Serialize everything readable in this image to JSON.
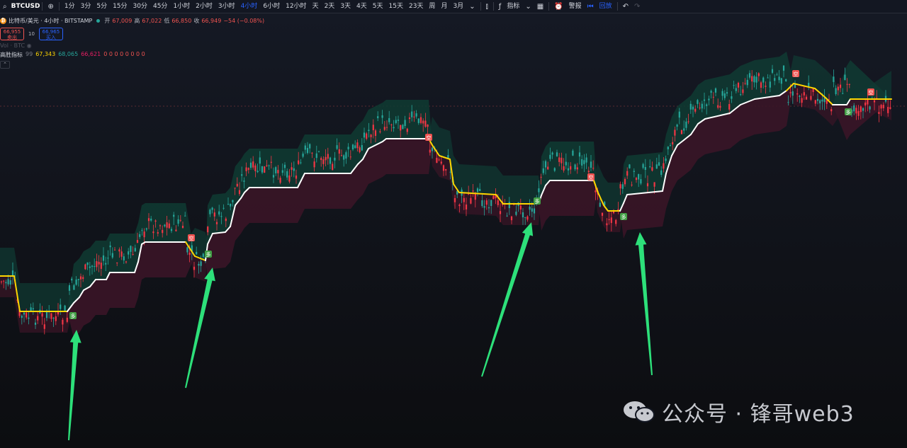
{
  "toolbar": {
    "symbol": "BTCUSD",
    "intervals": [
      "1分",
      "3分",
      "5分",
      "15分",
      "30分",
      "45分",
      "1小时",
      "2小时",
      "3小时",
      "4小时",
      "6小时",
      "12小时",
      "天",
      "2天",
      "3天",
      "4天",
      "5天",
      "15天",
      "23天",
      "周",
      "月",
      "3月"
    ],
    "active_interval": "4小时",
    "indicators_label": "指标",
    "alert_label": "警报",
    "replay_label": "回放"
  },
  "legend": {
    "title": "比特币/美元 · 4小时 · BITSTAMP",
    "open_k": "开",
    "open": "67,009",
    "high_k": "高",
    "high": "67,022",
    "low_k": "低",
    "low": "66,850",
    "close_k": "收",
    "close": "66,949",
    "change": "−54 (−0.08%)",
    "sell_price": "66,955",
    "sell_label": "卖出",
    "spread": "10",
    "buy_price": "66,965",
    "buy_label": "买入",
    "vol_label": "Vol · BTC",
    "ind_name": "高胜指标",
    "ind_param": "99",
    "ind_v1": "67,343",
    "ind_v2": "68,065",
    "ind_v3": "66,621",
    "ind_zeros": "0  0  0  0  0  0  0  0"
  },
  "colors": {
    "up": "#26a69a",
    "down": "#f23645",
    "band_up": "#0f3b33",
    "band_down": "#3a1527",
    "trail_bull": "#ffffff",
    "trail_bear": "#ffd600",
    "arrow": "#2de07a",
    "buy_sig": "#43a047",
    "sell_sig": "#ef5350"
  },
  "watermark": {
    "text": "公众号 · 锋哥web3"
  },
  "signals": [
    {
      "type": "buy",
      "text": "多"
    },
    {
      "type": "sell",
      "text": "空"
    },
    {
      "type": "buy",
      "text": "多"
    },
    {
      "type": "sell",
      "text": "空"
    },
    {
      "type": "buy",
      "text": "多"
    },
    {
      "type": "sell",
      "text": "空"
    },
    {
      "type": "buy",
      "text": "多"
    },
    {
      "type": "sell",
      "text": "空"
    },
    {
      "type": "buy",
      "text": "多"
    }
  ]
}
